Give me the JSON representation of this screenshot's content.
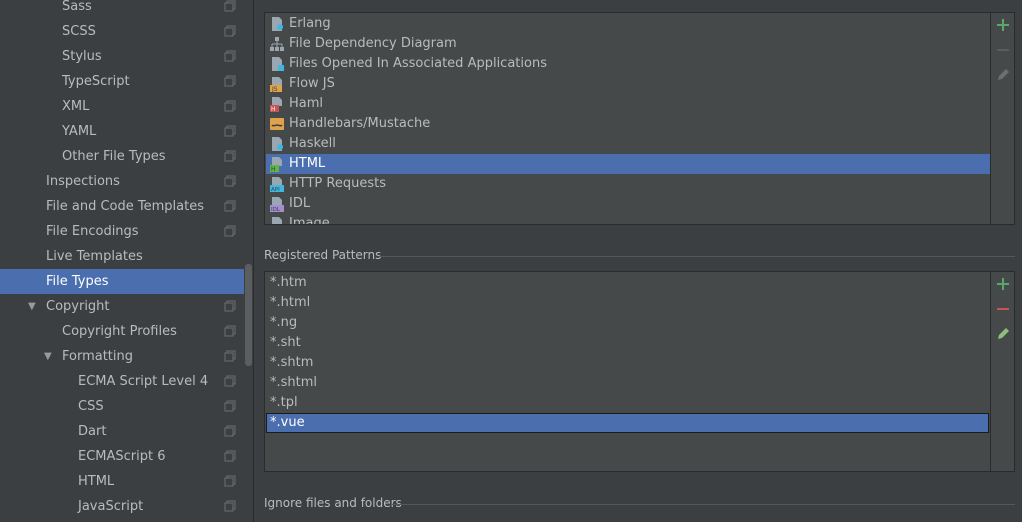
{
  "sidebar": {
    "items": [
      {
        "label": "Sass"
      },
      {
        "label": "SCSS"
      },
      {
        "label": "Stylus"
      },
      {
        "label": "TypeScript"
      },
      {
        "label": "XML"
      },
      {
        "label": "YAML"
      },
      {
        "label": "Other File Types"
      },
      {
        "label": "Inspections"
      },
      {
        "label": "File and Code Templates"
      },
      {
        "label": "File Encodings"
      },
      {
        "label": "Live Templates"
      },
      {
        "label": "File Types"
      },
      {
        "label": "Copyright"
      },
      {
        "label": "Copyright Profiles"
      },
      {
        "label": "Formatting"
      },
      {
        "label": "ECMA Script Level 4"
      },
      {
        "label": "CSS"
      },
      {
        "label": "Dart"
      },
      {
        "label": "ECMAScript 6"
      },
      {
        "label": "HTML"
      },
      {
        "label": "JavaScript"
      }
    ],
    "selected": "File Types"
  },
  "file_types": {
    "items": [
      {
        "label": "Erlang",
        "icon": "erlang-file-icon"
      },
      {
        "label": "File Dependency Diagram",
        "icon": "diagram-icon"
      },
      {
        "label": "Files Opened In Associated Applications",
        "icon": "external-file-icon"
      },
      {
        "label": "Flow JS",
        "icon": "js-file-icon"
      },
      {
        "label": "Haml",
        "icon": "haml-file-icon"
      },
      {
        "label": "Handlebars/Mustache",
        "icon": "handlebars-file-icon"
      },
      {
        "label": "Haskell",
        "icon": "haskell-file-icon"
      },
      {
        "label": "HTML",
        "icon": "html-file-icon"
      },
      {
        "label": "HTTP Requests",
        "icon": "api-file-icon"
      },
      {
        "label": "IDL",
        "icon": "idl-file-icon"
      },
      {
        "label": "Image",
        "icon": "image-file-icon"
      }
    ],
    "selected": "HTML"
  },
  "registered_patterns": {
    "title": "Registered Patterns",
    "items": [
      "*.htm",
      "*.html",
      "*.ng",
      "*.sht",
      "*.shtm",
      "*.shtml",
      "*.tpl",
      "*.vue"
    ],
    "selected": "*.vue"
  },
  "ignore_section": {
    "title": "Ignore files and folders"
  },
  "colors": {
    "background": "#3c3f41",
    "list_background": "#45494a",
    "selection": "#4b6eaf",
    "add_green": "#59a869",
    "remove_red": "#c75450",
    "edit_green": "#8ec07c"
  }
}
